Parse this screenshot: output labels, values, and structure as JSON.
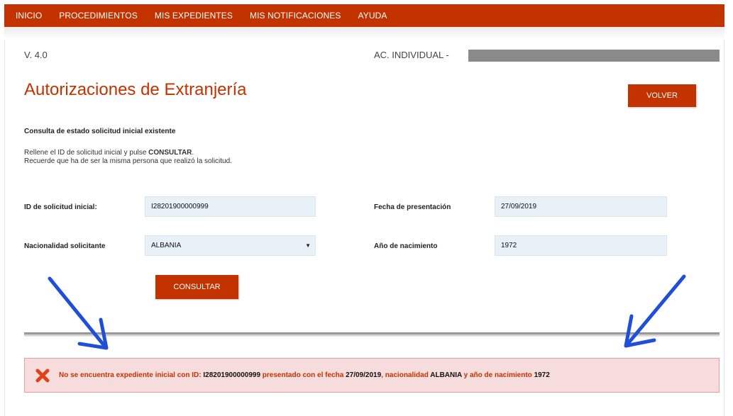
{
  "nav": {
    "items": [
      "INICIO",
      "PROCEDIMIENTOS",
      "MIS EXPEDIENTES",
      "MIS NOTIFICACIONES",
      "AYUDA"
    ]
  },
  "header": {
    "version": "V. 4.0",
    "ac_label": "AC. INDIVIDUAL -",
    "title": "Autorizaciones de Extranjería",
    "volver_label": "VOLVER"
  },
  "form": {
    "subtitle": "Consulta de estado solicitud inicial existente",
    "instr_pre": "Rellene el ID de solicitud inicial y pulse ",
    "instr_bold": "CONSULTAR",
    "instr_post": ".",
    "instr_line2": "Recuerde que ha de ser la misma persona que realizó la solicitud.",
    "id_label": "ID de solicitud inicial:",
    "id_value": "I28201900000999",
    "fecha_label": "Fecha de presentación",
    "fecha_value": "27/09/2019",
    "nacionalidad_label": "Nacionalidad solicitante",
    "nacionalidad_value": "ALBANIA",
    "ano_label": "Año de nacimiento",
    "ano_value": "1972",
    "consultar_label": "CONSULTAR"
  },
  "error": {
    "t1": "No se encuentra expediente inicial con ID: ",
    "id": "I28201900000999",
    "t2": " presentado con el fecha ",
    "fecha": "27/09/2019",
    "t3": ", nacionalidad ",
    "nacionalidad": "ALBANIA",
    "t4": " y año de nacimiento ",
    "ano": "1972",
    "icon": "close-x-icon",
    "icon_color": "#e0411a"
  },
  "colors": {
    "brand": "#c23300",
    "field_bg": "#e8f1f7",
    "error_bg": "#f6dcdc",
    "annotation_arrow": "#1f4fd8"
  }
}
